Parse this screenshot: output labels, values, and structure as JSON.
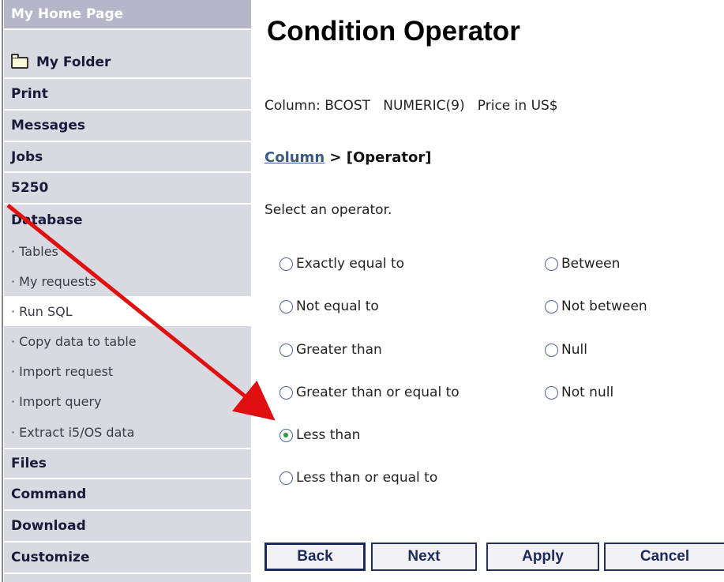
{
  "sidebar": {
    "items": [
      {
        "label": "My Home Page"
      },
      {
        "label": "My Folder"
      },
      {
        "label": "Print"
      },
      {
        "label": "Messages"
      },
      {
        "label": "Jobs"
      },
      {
        "label": "5250"
      },
      {
        "label": "Database"
      }
    ],
    "database_sub": [
      {
        "label": "· Tables"
      },
      {
        "label": "· My requests"
      },
      {
        "label": "· Run SQL"
      },
      {
        "label": "· Copy data to table"
      },
      {
        "label": "· Import request"
      },
      {
        "label": "· Import query"
      },
      {
        "label": "· Extract i5/OS data"
      }
    ],
    "after": [
      {
        "label": "Files"
      },
      {
        "label": "Command"
      },
      {
        "label": "Download"
      },
      {
        "label": "Customize"
      }
    ]
  },
  "main": {
    "title": "Condition Operator",
    "column_info": "Column: BCOST   NUMERIC(9)   Price in US$",
    "breadcrumb": {
      "link": "Column",
      "current": " > [Operator]"
    },
    "prompt": "Select an operator.",
    "operators_left": [
      {
        "label": "Exactly equal to",
        "checked": false
      },
      {
        "label": "Not equal to",
        "checked": false
      },
      {
        "label": "Greater than",
        "checked": false
      },
      {
        "label": "Greater than or equal to",
        "checked": false
      },
      {
        "label": "Less than",
        "checked": true
      },
      {
        "label": "Less than or equal to",
        "checked": false
      }
    ],
    "operators_right": [
      {
        "label": "Between",
        "checked": false
      },
      {
        "label": "Not between",
        "checked": false
      },
      {
        "label": "Null",
        "checked": false
      },
      {
        "label": "Not null",
        "checked": false
      }
    ],
    "buttons": {
      "back": "Back",
      "next": "Next",
      "apply": "Apply",
      "cancel": "Cancel"
    }
  },
  "colors": {
    "sidebar_bg": "#d9d9e2",
    "arrow": "#e01010",
    "radio_checked": "#2a9a3a"
  }
}
